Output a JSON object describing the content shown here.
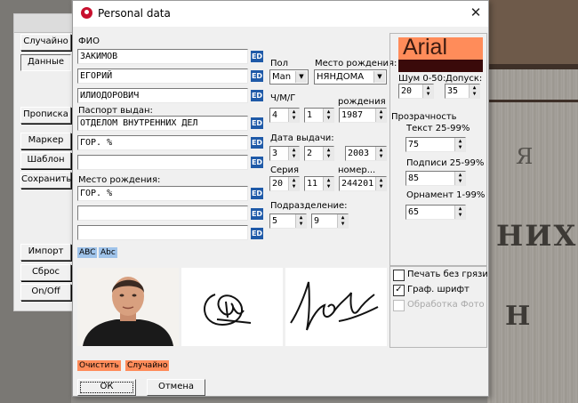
{
  "window": {
    "title": "Personal data",
    "close_glyph": "✕"
  },
  "side_buttons": [
    "Случайно",
    "Данные",
    "Прописка",
    "Маркер",
    "Шаблон",
    "Сохранить",
    "Импорт",
    "Сброс",
    "On/Off"
  ],
  "left": {
    "fio_label": "ФИО",
    "surname": "ЗАКИМОВ",
    "name": "ЕГОРИЙ",
    "patronymic": "ИЛИОДОРОВИЧ",
    "passport_label": "Паспорт выдан:",
    "issued_1": "ОТДЕЛОМ ВНУТРЕННИХ ДЕЛ",
    "issued_2": "ГОР. %",
    "issued_3": "",
    "birthplace_label": "Место рождения:",
    "birth_1": "ГОР. %",
    "birth_2": "",
    "birth_3": "",
    "ed_label": "ED",
    "case_upper": "ABC",
    "case_mixed": "Abc",
    "clear_label": "Очистить",
    "random_label": "Случайно"
  },
  "middle": {
    "sex_label": "Пол",
    "sex_value": "Man",
    "birthplace_label": "Место рождения:",
    "birthplace_value": "НЯНДОМА",
    "dmy_label": "Ч/М/Г",
    "birth_label": "рождения",
    "birth_d": "4",
    "birth_m": "1",
    "birth_y": "1987",
    "issue_label": "Дата выдачи:",
    "issue_d": "3",
    "issue_m": "2",
    "issue_y": "2003",
    "series_label": "Серия",
    "number_label": "номер...",
    "series_1": "20",
    "series_2": "11",
    "number": "244201",
    "subdiv_label": "Подразделение:",
    "subdiv_1": "5",
    "subdiv_2": "9"
  },
  "right": {
    "font_preview": "Arial",
    "noise_label": "Шум 0-50:",
    "noise_value": "20",
    "tolerance_label": "Допуск:",
    "tolerance_value": "35",
    "transparency_label": "Прозрачность",
    "text_label": "Текст 25-99%",
    "text_value": "75",
    "sign_label": "Подписи 25-99%",
    "sign_value": "85",
    "ornament_label": "Орнамент 1-99%",
    "ornament_value": "65",
    "print_clean_label": "Печать без грязи",
    "print_clean_checked": false,
    "graph_font_label": "Граф. шрифт",
    "graph_font_checked": true,
    "photo_proc_label": "Обработка Фото",
    "photo_proc_checked": false
  },
  "footer": {
    "ok_label": "ОК",
    "cancel_label": "Отмена"
  },
  "background_text": {
    "line1": "Я",
    "line2": "НИХ",
    "line3": "Н"
  },
  "colors": {
    "accent_orange": "#ff8c5a",
    "ed_blue": "#1f5aa8",
    "chip_blue": "#9fc3ea"
  }
}
